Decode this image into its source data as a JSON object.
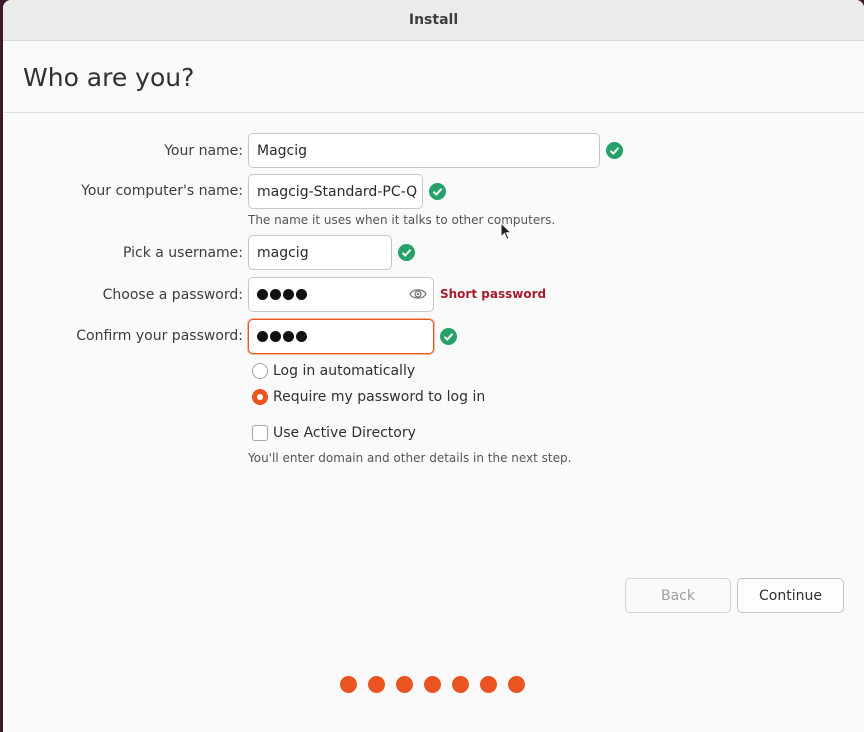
{
  "window": {
    "title": "Install"
  },
  "page": {
    "title": "Who are you?"
  },
  "form": {
    "name_label": "Your name:",
    "name_value": "Magcig",
    "computer_label": "Your computer's name:",
    "computer_value": "magcig-Standard-PC-Q",
    "computer_hint": "The name it uses when it talks to other computers.",
    "username_label": "Pick a username:",
    "username_value": "magcig",
    "password_label": "Choose a password:",
    "password_length": 4,
    "password_strength": "Short password",
    "confirm_label": "Confirm your password:",
    "confirm_length": 4
  },
  "login_options": {
    "auto_label": "Log in automatically",
    "require_label": "Require my password to log in",
    "selected": "require"
  },
  "active_directory": {
    "label": "Use Active Directory",
    "checked": false,
    "hint": "You'll enter domain and other details in the next step."
  },
  "buttons": {
    "back": "Back",
    "continue": "Continue"
  },
  "progress": {
    "total_steps": 7
  },
  "colors": {
    "accent": "#e95420",
    "valid": "#26a269",
    "error": "#a51d2d"
  }
}
